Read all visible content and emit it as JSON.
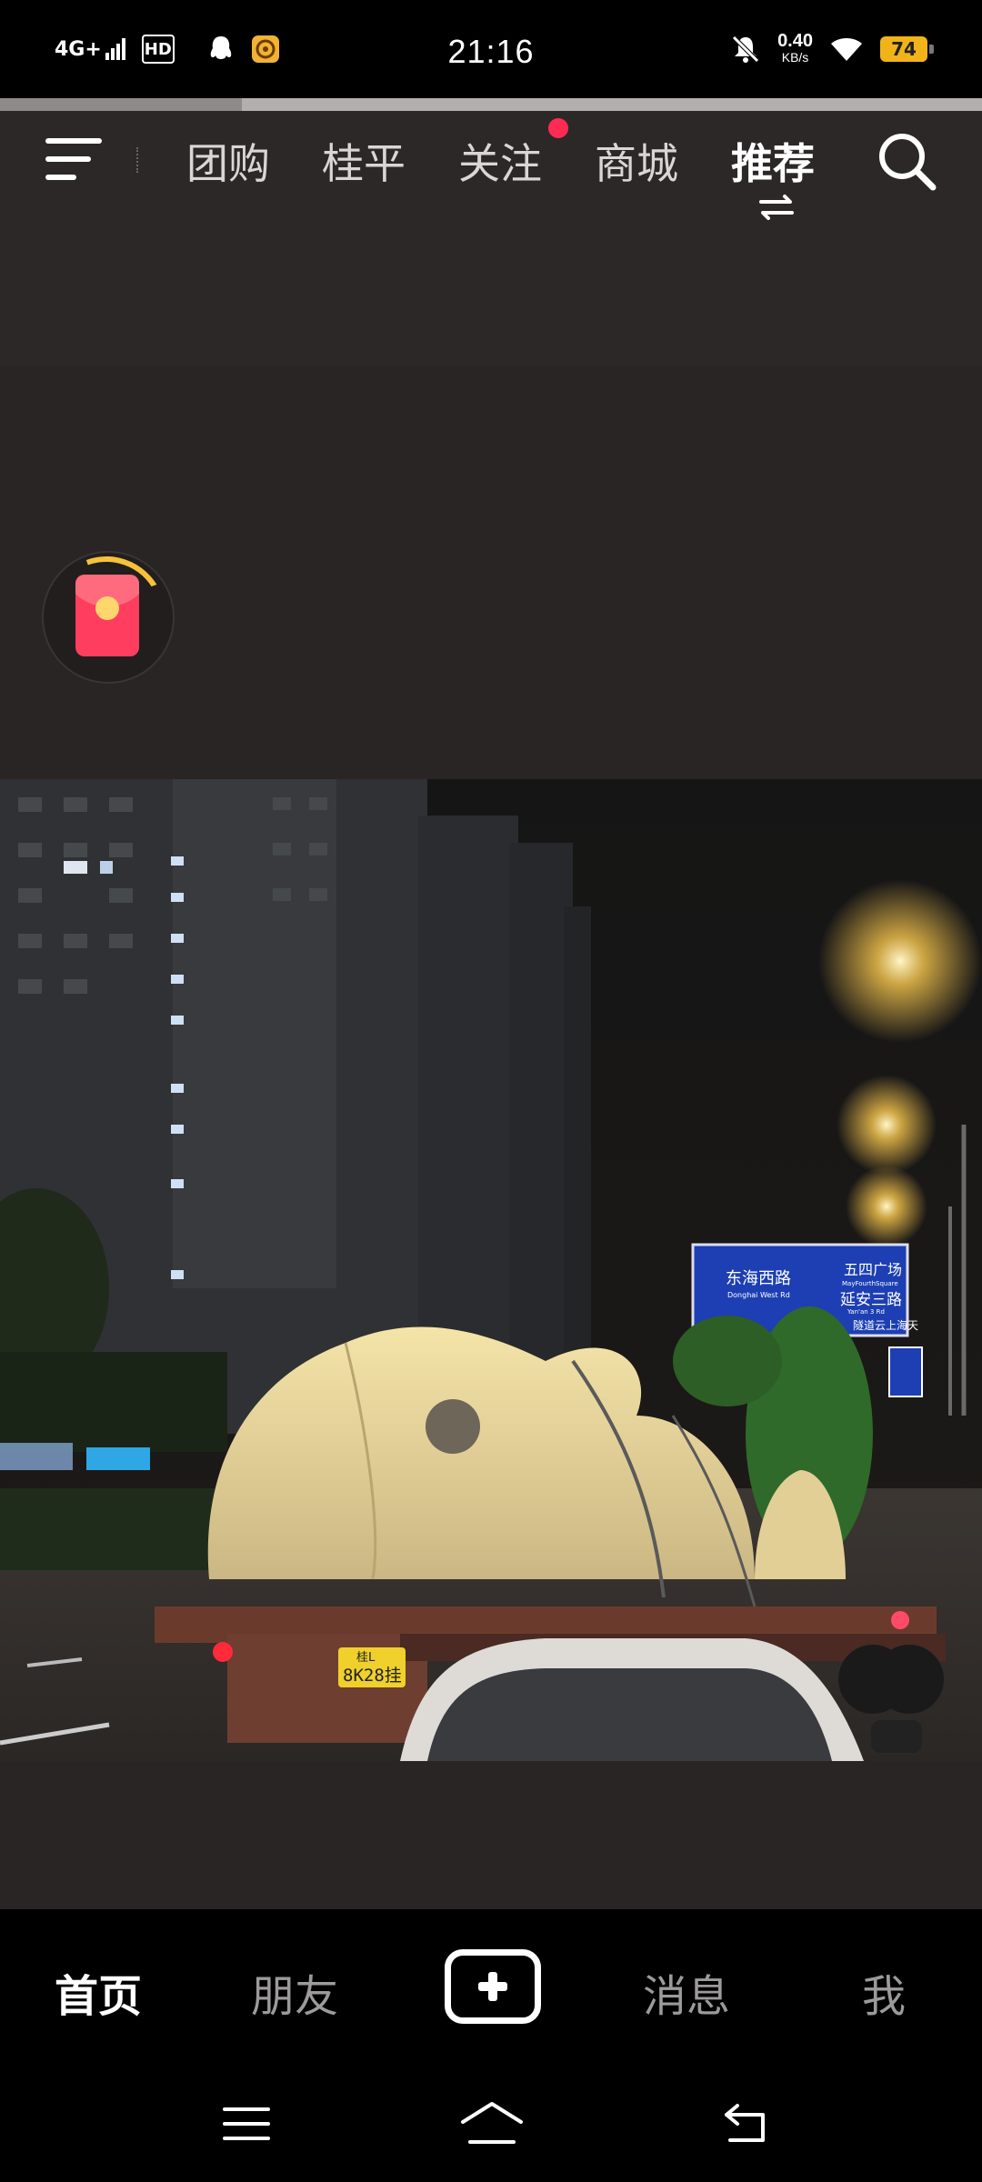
{
  "status_bar": {
    "network": "4G+",
    "hd": "HD",
    "time": "21:16",
    "speed_value": "0.40",
    "speed_unit": "KB/s",
    "battery": "74"
  },
  "nav": {
    "tabs": [
      {
        "label": "团购"
      },
      {
        "label": "桂平"
      },
      {
        "label": "关注"
      },
      {
        "label": "商城"
      },
      {
        "label": "推荐"
      }
    ],
    "active_tab": "推荐"
  },
  "photo": {
    "sign_left": "东海西路",
    "sign_left_en": "Donghai West Rd",
    "sign_right_top": "五四广场",
    "sign_right_top_en": "MayFourthSquare",
    "sign_right_mid": "延安三路",
    "sign_right_mid_en": "Yan'an 3 Rd",
    "sign_right_bottom": "隧道云上海天",
    "plate_top": "桂L",
    "plate_bottom": "8K28挂"
  },
  "bottom_tabs": [
    {
      "label": "首页"
    },
    {
      "label": "朋友"
    },
    {
      "label": "消息"
    },
    {
      "label": "我"
    }
  ],
  "colors": {
    "accent_dot": "#ff2b55",
    "red_packet": "#ff3e5f",
    "battery": "#f0b31a"
  }
}
